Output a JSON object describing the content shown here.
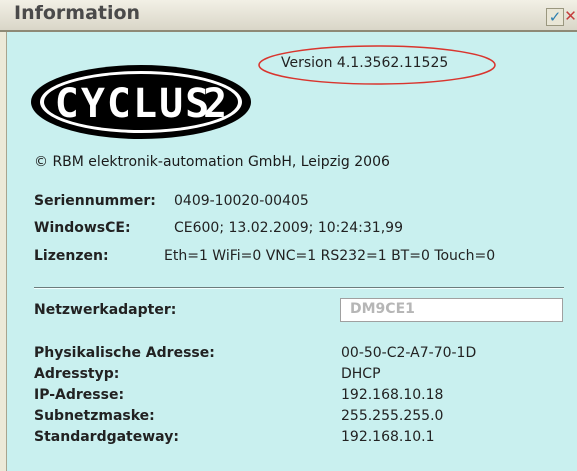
{
  "window": {
    "title": "Information",
    "ok_symbol": "✓",
    "close_symbol": "✕"
  },
  "logo": {
    "text": "CYCLUS 2",
    "icon": "cyclus-logo"
  },
  "version": "Version 4.1.3562.11525",
  "copyright": "© RBM elektronik-automation GmbH, Leipzig 2006",
  "info": [
    {
      "label": "Seriennummer:",
      "value": "0409-10020-00405"
    },
    {
      "label": "WindowsCE:",
      "value": "CE600; 13.02.2009; 10:24:31,99"
    },
    {
      "label": "Lizenzen:",
      "value": "Eth=1 WiFi=0 VNC=1 RS232=1 BT=0 Touch=0"
    }
  ],
  "network": {
    "adapter_label": "Netzwerkadapter:",
    "adapter_value": "DM9CE1",
    "rows": [
      {
        "label": "Physikalische Adresse:",
        "value": "00-50-C2-A7-70-1D"
      },
      {
        "label": "Adresstyp:",
        "value": "DHCP"
      },
      {
        "label": "IP-Adresse:",
        "value": "192.168.10.18"
      },
      {
        "label": "Subnetzmaske:",
        "value": "255.255.255.0"
      },
      {
        "label": "Standardgateway:",
        "value": "192.168.10.1"
      }
    ]
  },
  "colors": {
    "background": "#c9f0ef",
    "highlight_ellipse": "#d9352e"
  }
}
